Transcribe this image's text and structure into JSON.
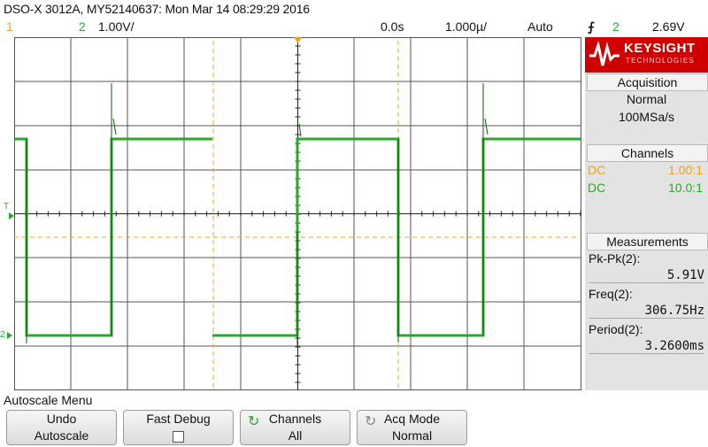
{
  "header": {
    "title": "DSO-X 3012A, MY52140637: Mon Mar 14 08:29:29 2016"
  },
  "status": {
    "ch1_label": "1",
    "ch2_label": "2",
    "ch2_scale": "1.00V/",
    "time_offset": "0.0s",
    "time_scale": "1.000µ/",
    "trigger_mode": "Auto",
    "trigger_slope": "⨍",
    "trigger_source": "2",
    "trigger_level": "2.69V"
  },
  "brand": {
    "name": "KEYSIGHT",
    "sub": "TECHNOLOGIES"
  },
  "acquisition": {
    "title": "Acquisition",
    "mode": "Normal",
    "rate": "100MSa/s"
  },
  "channels": {
    "title": "Channels",
    "rows": [
      {
        "coupling": "DC",
        "ratio": "1.00:1",
        "color": "#f0a020"
      },
      {
        "coupling": "DC",
        "ratio": "10.0:1",
        "color": "#2aa82a"
      }
    ]
  },
  "measurements": {
    "title": "Measurements",
    "items": [
      {
        "label": "Pk-Pk(2):",
        "value": "5.91V"
      },
      {
        "label": "Freq(2):",
        "value": "306.75Hz"
      },
      {
        "label": "Period(2):",
        "value": "3.2600ms"
      }
    ]
  },
  "screen": {
    "trigger_marker": "T",
    "ch2_ground_marker": "2"
  },
  "menu": {
    "title": "Autoscale Menu",
    "keys": [
      {
        "l1": "Undo",
        "l2": "Autoscale"
      },
      {
        "l1": "Fast Debug",
        "l2": ""
      },
      {
        "l1": "Channels",
        "l2": "All"
      },
      {
        "l1": "Acq Mode",
        "l2": "Normal"
      }
    ]
  },
  "colors": {
    "ch1": "#f0a020",
    "ch2": "#2aa82a",
    "grid": "#3a3a3a",
    "accent": "#cc0000"
  }
}
